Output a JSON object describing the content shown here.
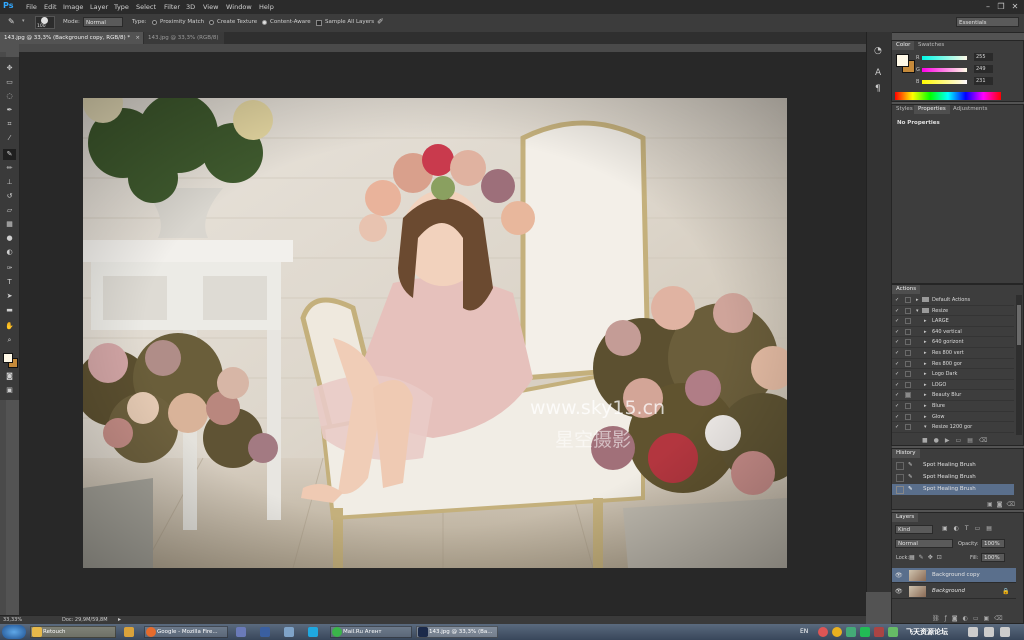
{
  "app": {
    "logo": "Ps"
  },
  "menu": [
    "File",
    "Edit",
    "Image",
    "Layer",
    "Type",
    "Select",
    "Filter",
    "3D",
    "View",
    "Window",
    "Help"
  ],
  "window_controls": {
    "minimize": "–",
    "restore": "❐",
    "close": "✕"
  },
  "options_bar": {
    "brush_size": "100",
    "mode_label": "Mode:",
    "mode_value": "Normal",
    "type_label": "Type:",
    "type_options": [
      "Proximity Match",
      "Create Texture",
      "Content-Aware"
    ],
    "type_selected": "Content-Aware",
    "sample_all_layers": "Sample All Layers",
    "workspace": "Essentials"
  },
  "documents": [
    {
      "title": "143.jpg @ 33,3% (Background copy, RGB/8) *",
      "active": true
    },
    {
      "title": "143.jpg @ 33,3% (RGB/8)",
      "active": false
    }
  ],
  "status": {
    "zoom": "33,33%",
    "doc": "Doc: 29,9M/59,8M"
  },
  "watermark": {
    "line1": "www.sky15.cn",
    "line2": "星空摄影"
  },
  "color_panel": {
    "tabs": [
      "Color",
      "Swatches"
    ],
    "r": {
      "label": "R",
      "value": "255"
    },
    "g": {
      "label": "G",
      "value": "249"
    },
    "b": {
      "label": "B",
      "value": "231"
    },
    "foreground": "#fff9e7"
  },
  "properties_panel": {
    "tabs": [
      "Styles",
      "Properties",
      "Adjustments"
    ],
    "content": "No Properties"
  },
  "actions_panel": {
    "title": "Actions",
    "items": [
      {
        "label": "Default Actions",
        "level": 0,
        "folder": true,
        "open": false
      },
      {
        "label": "Resize",
        "level": 0,
        "folder": true,
        "open": true
      },
      {
        "label": "LARGE",
        "level": 1
      },
      {
        "label": "640 vertical",
        "level": 1
      },
      {
        "label": "640 gorizont",
        "level": 1
      },
      {
        "label": "Res 800 vert",
        "level": 1
      },
      {
        "label": "Res 800 gor",
        "level": 1
      },
      {
        "label": "Logo Dark",
        "level": 1
      },
      {
        "label": "LOGO",
        "level": 1
      },
      {
        "label": "Beauty Blur",
        "level": 1
      },
      {
        "label": "Blure",
        "level": 1
      },
      {
        "label": "Glow",
        "level": 1
      },
      {
        "label": "Resize 1200 gor",
        "level": 1,
        "open": true
      }
    ]
  },
  "history_panel": {
    "title": "History",
    "items": [
      "Spot Healing Brush",
      "Spot Healing Brush",
      "Spot Healing Brush"
    ],
    "selected_index": 2
  },
  "layers_panel": {
    "title": "Layers",
    "kind": "Kind",
    "blend_mode": "Normal",
    "opacity_label": "Opacity:",
    "opacity_value": "100%",
    "lock_label": "Lock:",
    "fill_label": "Fill:",
    "fill_value": "100%",
    "layers": [
      {
        "name": "Background copy",
        "selected": true
      },
      {
        "name": "Background",
        "selected": false,
        "locked": true
      }
    ]
  },
  "taskbar": {
    "items": [
      {
        "label": "Retouch"
      },
      {
        "label": "Google - Mozilla Fire..."
      },
      {
        "label": "Mail.Ru Агент"
      },
      {
        "label": "143.jpg @ 33,3% (Ba..."
      }
    ],
    "lang": "EN",
    "tray_text": "飞天资源论坛"
  }
}
